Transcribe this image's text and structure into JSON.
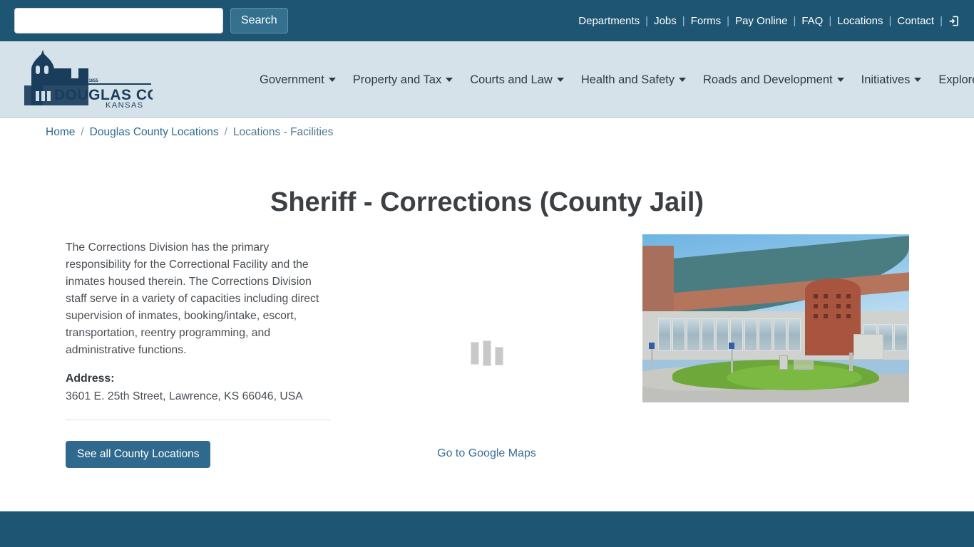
{
  "topbar": {
    "search_value": "",
    "search_placeholder": "",
    "search_button": "Search",
    "links": [
      {
        "label": "Departments"
      },
      {
        "label": "Jobs"
      },
      {
        "label": "Forms"
      },
      {
        "label": "Pay Online"
      },
      {
        "label": "FAQ"
      },
      {
        "label": "Locations"
      },
      {
        "label": "Contact"
      }
    ],
    "separator": "|",
    "signin_icon": "sign-in-icon"
  },
  "brand": {
    "logo_icon": "courthouse-logo-icon",
    "name_line1": "DOUGLAS  COUNTY",
    "name_line2": "KANSAS",
    "established": "EST. 1855"
  },
  "mainnav": {
    "items": [
      {
        "label": "Government",
        "has_dropdown": true
      },
      {
        "label": "Property and Tax",
        "has_dropdown": true
      },
      {
        "label": "Courts and Law",
        "has_dropdown": true
      },
      {
        "label": "Health and Safety",
        "has_dropdown": true
      },
      {
        "label": "Roads and Development",
        "has_dropdown": true
      },
      {
        "label": "Initiatives",
        "has_dropdown": true
      },
      {
        "label": "Explore",
        "has_dropdown": true
      }
    ]
  },
  "breadcrumb": {
    "separator": "/",
    "items": [
      {
        "label": "Home",
        "current": false
      },
      {
        "label": "Douglas County Locations",
        "current": false
      },
      {
        "label": "Locations - Facilities",
        "current": true
      }
    ]
  },
  "main": {
    "page_title": "Sheriff - Corrections (County Jail)",
    "description": "The Corrections Division has the primary responsibility for the Correctional Facility and the inmates housed therein. The Corrections Division staff serve in a variety of capacities including direct supervision of inmates, booking/intake, escort, transportation, reentry programming, and administrative functions.",
    "address_label": "Address:",
    "address_value": "3601 E. 25th Street, Lawrence, KS 66046, USA",
    "locations_button": "See all County Locations",
    "map_link": "Go to Google Maps",
    "map_loader_icon": "loading-bars-icon",
    "photo_alt": "douglas-county-correctional-facility-photo"
  },
  "colors": {
    "topbar_bg": "#1e5573",
    "navband_bg": "#d5e2ea",
    "accent_button": "#2f6a8e",
    "link": "#2f6a8e",
    "footer_bg": "#1e5573"
  }
}
